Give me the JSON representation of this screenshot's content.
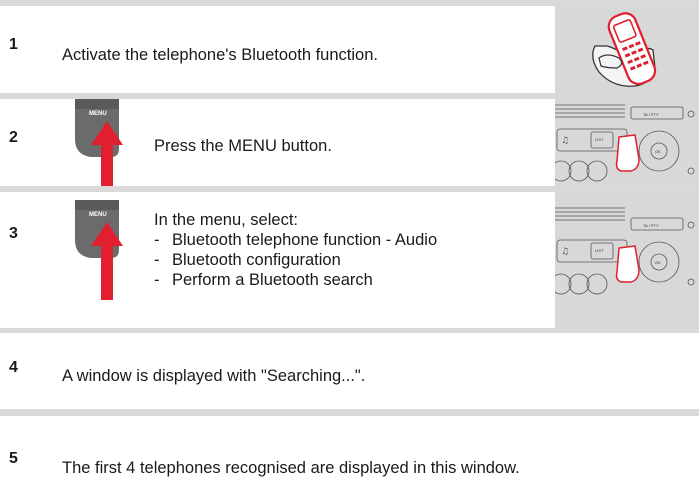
{
  "steps": [
    {
      "number": "1",
      "text": "Activate the telephone's Bluetooth function."
    },
    {
      "number": "2",
      "text": "Press the MENU button."
    },
    {
      "number": "3",
      "text": "In the menu, select:",
      "options": [
        "Bluetooth telephone function - Audio",
        "Bluetooth configuration",
        "Perform a Bluetooth search"
      ]
    },
    {
      "number": "4",
      "text": "A window is displayed with \"Searching...\"."
    },
    {
      "number": "5",
      "text": "The first 4 telephones recognised are displayed in this window."
    }
  ],
  "menu_button_label": "MENU",
  "radio_labels": {
    "ta_pty": "TA / PTY",
    "list": "LIST",
    "ok": "OK"
  },
  "colors": {
    "bar": "#d9d9d9",
    "thumb_bg": "#d8d8d8",
    "accent_red": "#e0202e",
    "menu_grey": "#6b6b6b"
  }
}
